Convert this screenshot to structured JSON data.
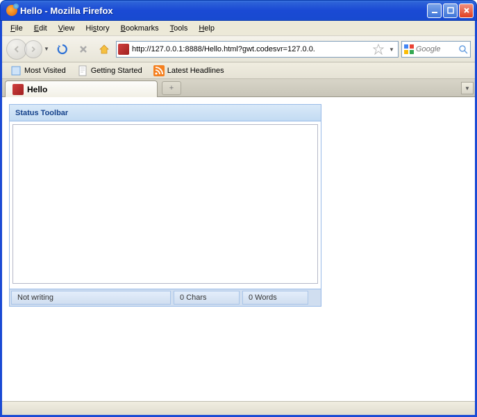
{
  "window": {
    "title": "Hello - Mozilla Firefox"
  },
  "menu": {
    "file": "File",
    "edit": "Edit",
    "view": "View",
    "history": "History",
    "bookmarks": "Bookmarks",
    "tools": "Tools",
    "help": "Help"
  },
  "url": "http://127.0.0.1:8888/Hello.html?gwt.codesvr=127.0.0.",
  "search": {
    "placeholder": "Google"
  },
  "bookmarks_toolbar": {
    "most_visited": "Most Visited",
    "getting_started": "Getting Started",
    "latest_headlines": "Latest Headlines"
  },
  "tab": {
    "title": "Hello",
    "new_tab": "+"
  },
  "panel": {
    "title": "Status Toolbar",
    "status": "Not writing",
    "chars": "0 Chars",
    "words": "0 Words"
  }
}
